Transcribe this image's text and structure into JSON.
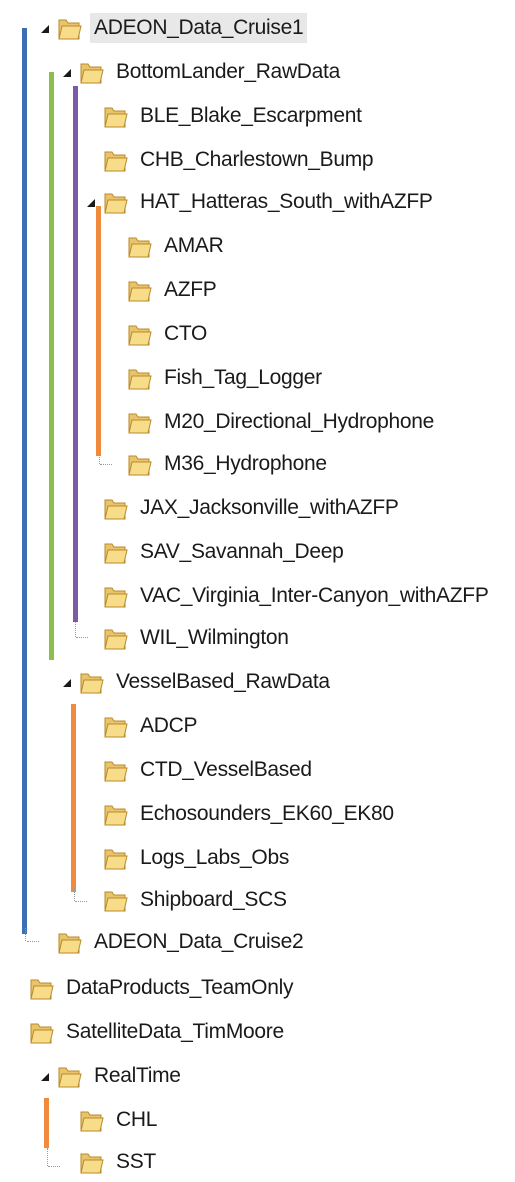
{
  "tree": {
    "items": [
      {
        "label": "ADEON_Data_Cruise1",
        "expanded": true,
        "depth": "level-1",
        "selected": true
      },
      {
        "label": "BottomLander_RawData",
        "expanded": true,
        "depth": "level-2"
      },
      {
        "label": "BLE_Blake_Escarpment",
        "depth": "level-3"
      },
      {
        "label": "CHB_Charlestown_Bump",
        "depth": "level-3"
      },
      {
        "label": "HAT_Hatteras_South_withAZFP",
        "expanded": true,
        "depth": "level-3"
      },
      {
        "label": "AMAR",
        "depth": "level-4"
      },
      {
        "label": "AZFP",
        "depth": "level-4"
      },
      {
        "label": "CTO",
        "depth": "level-4"
      },
      {
        "label": "Fish_Tag_Logger",
        "depth": "level-4"
      },
      {
        "label": "M20_Directional_Hydrophone",
        "depth": "level-4"
      },
      {
        "label": "M36_Hydrophone",
        "depth": "level-4"
      },
      {
        "label": "JAX_Jacksonville_withAZFP",
        "depth": "level-3"
      },
      {
        "label": "SAV_Savannah_Deep",
        "depth": "level-3"
      },
      {
        "label": "VAC_Virginia_Inter-Canyon_withAZFP",
        "depth": "level-3"
      },
      {
        "label": "WIL_Wilmington",
        "depth": "level-3"
      },
      {
        "label": "VesselBased_RawData",
        "expanded": true,
        "depth": "level-2"
      },
      {
        "label": "ADCP",
        "depth": "level-3"
      },
      {
        "label": "CTD_VesselBased",
        "depth": "level-3"
      },
      {
        "label": "Echosounders_EK60_EK80",
        "depth": "level-3"
      },
      {
        "label": "Logs_Labs_Obs",
        "depth": "level-3"
      },
      {
        "label": "Shipboard_SCS",
        "depth": "level-3"
      },
      {
        "label": "ADEON_Data_Cruise2",
        "depth": "level-1"
      },
      {
        "label": "DataProducts_TeamOnly",
        "depth": "level-0"
      },
      {
        "label": "SatelliteData_TimMoore",
        "depth": "level-0"
      },
      {
        "label": "RealTime",
        "expanded": true,
        "depth": "level-1"
      },
      {
        "label": "CHL",
        "depth": "level-2"
      },
      {
        "label": "SST",
        "depth": "level-2"
      }
    ]
  },
  "colors": {
    "blue_line": "#3d6db5",
    "green_line": "#8dc04a",
    "purple_line": "#7b5aa6",
    "orange_line": "#f08a3c",
    "folder_body": "#e9c46a",
    "folder_front": "#f7dc8a",
    "folder_edge": "#b98a2a"
  },
  "icons": {
    "folder": "folder-icon",
    "expanded": "expanded-triangle-icon"
  }
}
